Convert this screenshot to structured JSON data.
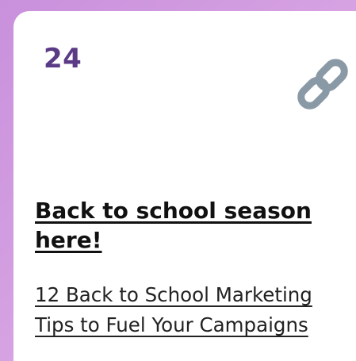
{
  "card": {
    "day_number": "24",
    "headline_line1": "Back to school season",
    "headline_line2": "here!",
    "subtitle_line1": "12 Back to School Marketing",
    "subtitle_line2": "Tips to Fuel Your Campaigns",
    "icon": "link-icon"
  },
  "colors": {
    "background": "#d3a0e0",
    "card": "#ffffff",
    "day_number": "#5b3a86",
    "icon": "#8a99a6",
    "text": "#111111"
  }
}
